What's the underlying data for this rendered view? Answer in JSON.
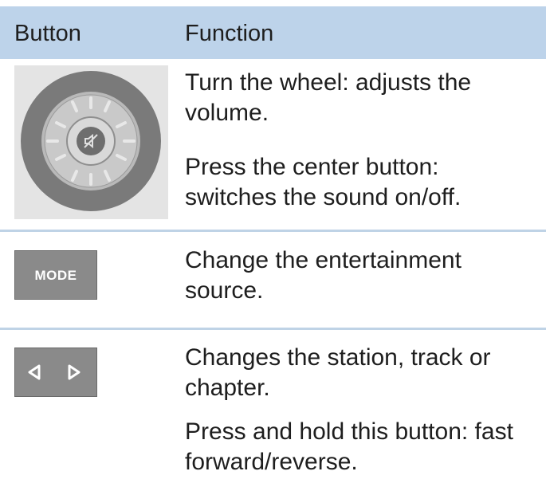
{
  "header": {
    "col_button": "Button",
    "col_function": "Function"
  },
  "rows": [
    {
      "button": {
        "icon": "volume-wheel-icon"
      },
      "function": [
        "Turn the wheel: adjusts the volume.",
        "Press the center button: switches the sound on/off."
      ]
    },
    {
      "button": {
        "icon": "mode-button-icon",
        "label": "MODE"
      },
      "function": [
        "Change the entertainment source."
      ]
    },
    {
      "button": {
        "icon": "previous-next-arrows-icon"
      },
      "function": [
        "Changes the station, track or chapter.",
        "Press and hold this button: fast forward/reverse."
      ]
    }
  ],
  "colors": {
    "header_bg": "#bdd3ea",
    "divider": "#bfd3e6",
    "key_grey": "#8a8a8a"
  }
}
